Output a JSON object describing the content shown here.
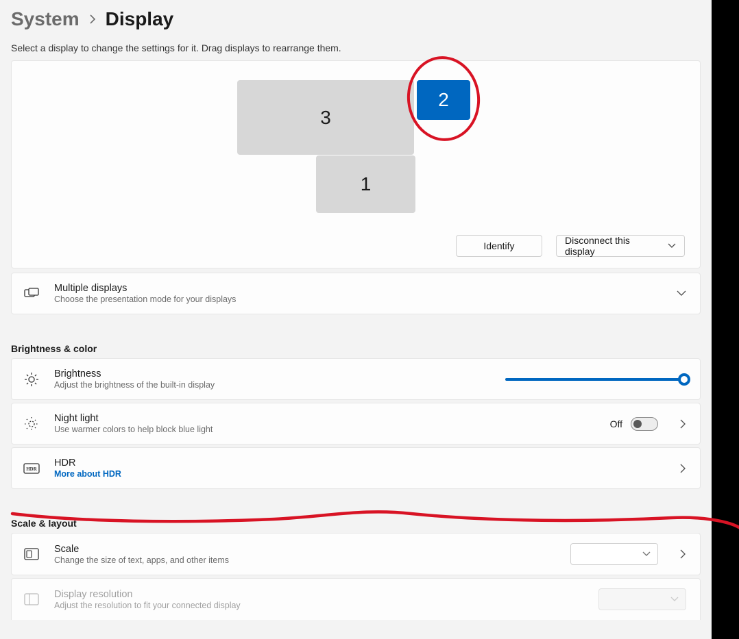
{
  "breadcrumb": {
    "parent": "System",
    "current": "Display"
  },
  "helper_text": "Select a display to change the settings for it. Drag displays to rearrange them.",
  "monitors": {
    "m1": "1",
    "m2": "2",
    "m3": "3"
  },
  "actions": {
    "identify": "Identify",
    "disconnect": "Disconnect this display"
  },
  "rows": {
    "multiple": {
      "title": "Multiple displays",
      "sub": "Choose the presentation mode for your displays"
    },
    "brightness": {
      "title": "Brightness",
      "sub": "Adjust the brightness of the built-in display",
      "value_pct": 100
    },
    "nightlight": {
      "title": "Night light",
      "sub": "Use warmer colors to help block blue light",
      "state_label": "Off",
      "on": false
    },
    "hdr": {
      "title": "HDR",
      "link": "More about HDR"
    },
    "scale": {
      "title": "Scale",
      "sub": "Change the size of text, apps, and other items",
      "value": ""
    },
    "resolution": {
      "title": "Display resolution",
      "sub": "Adjust the resolution to fit your connected display",
      "value": ""
    }
  },
  "sections": {
    "brightness_color": "Brightness & color",
    "scale_layout": "Scale & layout"
  },
  "colors": {
    "accent": "#0067c0",
    "annotation": "#d81324"
  }
}
